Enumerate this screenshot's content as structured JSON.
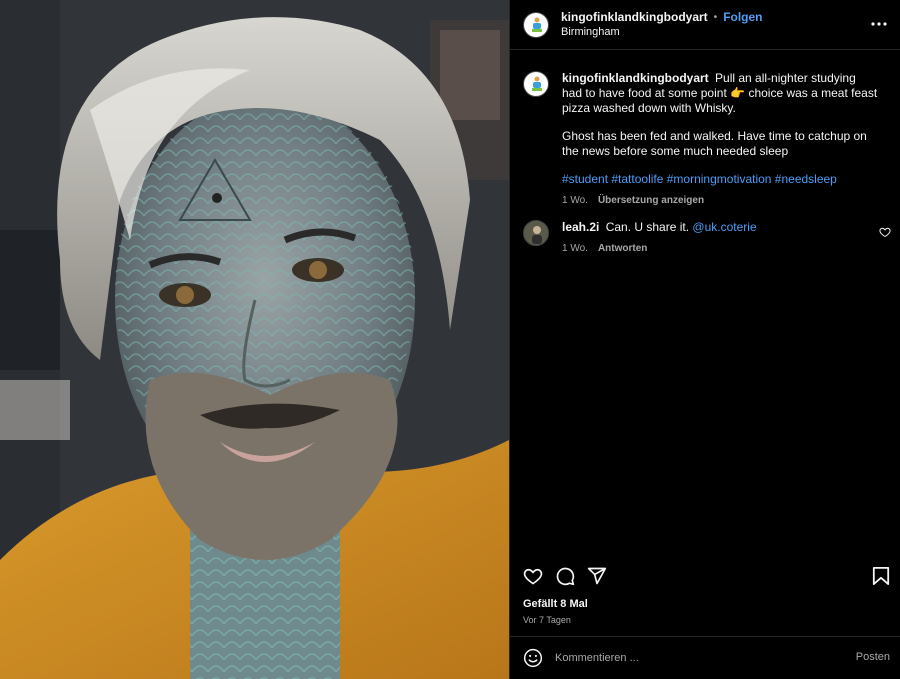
{
  "post": {
    "username": "kingofinklandkingbodyart",
    "separator": "•",
    "follow_label": "Folgen",
    "location": "Birmingham",
    "more_icon": "more-horizontal-icon"
  },
  "caption": {
    "username": "kingofinklandkingbodyart",
    "text_part1": "Pull an all-nighter studying had to have food at some point",
    "emoji": "👉",
    "text_part2": "choice was a meat feast pizza washed down with Whisky.",
    "paragraph2": "Ghost has been fed and walked. Have time to catchup on the news before some much needed sleep",
    "hashtags": "#student #tattoolife #morningmotivation #needsleep",
    "time": "1 Wo.",
    "translate_label": "Übersetzung anzeigen"
  },
  "comment": {
    "username": "leah.2i",
    "text": "Can. U share it.",
    "mention": "@uk.coterie",
    "time": "1 Wo.",
    "reply_label": "Antworten"
  },
  "actions": {
    "like_icon": "heart-icon",
    "comment_icon": "comment-icon",
    "share_icon": "send-icon",
    "save_icon": "bookmark-icon",
    "likes_label": "Gefällt 8 Mal",
    "posted_label": "Vor 7 Tagen"
  },
  "composer": {
    "placeholder": "Kommentieren ...",
    "post_label": "Posten",
    "emoji_icon": "smiley-icon"
  },
  "colors": {
    "background": "#000000",
    "link_blue": "#4f9df7",
    "muted": "#a8a8a8",
    "text": "#f5f5f5"
  }
}
